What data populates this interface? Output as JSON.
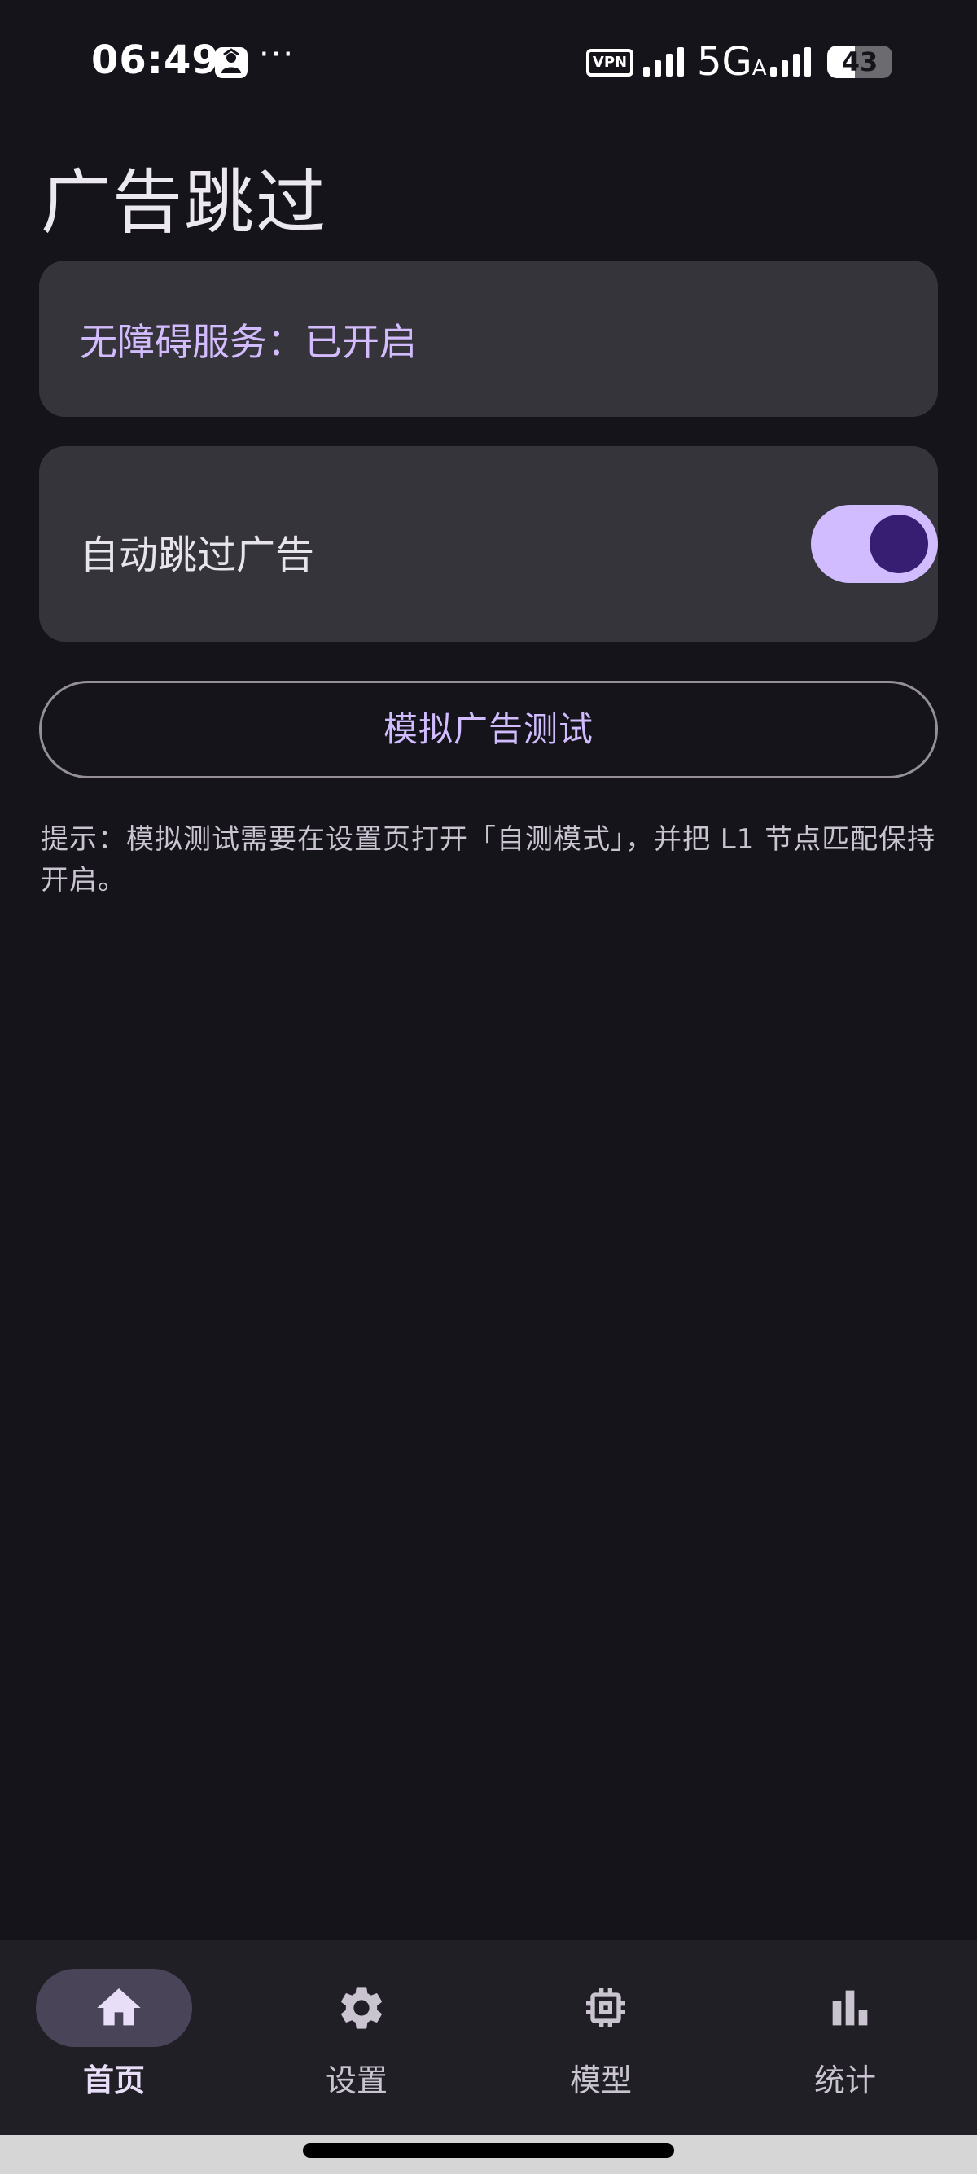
{
  "status_bar": {
    "time": "06:49",
    "app_notification_icon": "portrait-icon",
    "more_indicator": "···",
    "vpn_label": "VPN",
    "network_type": "5G",
    "network_sub": "A",
    "battery_level": "43",
    "battery_fraction": 0.43
  },
  "page": {
    "title": "广告跳过"
  },
  "accessibility_card": {
    "status_text": "无障碍服务：已开启",
    "accent_color": "#d2bcfd"
  },
  "auto_skip_card": {
    "label": "自动跳过广告",
    "toggle_on": true
  },
  "simulate_button": {
    "label": "模拟广告测试"
  },
  "hint": {
    "text": "提示：模拟测试需要在设置页打开「自测模式」，并把 L1 节点匹配保持开启。"
  },
  "bottom_nav": {
    "items": [
      {
        "label": "首页",
        "icon": "home-icon",
        "selected": true
      },
      {
        "label": "设置",
        "icon": "gear-icon",
        "selected": false
      },
      {
        "label": "模型",
        "icon": "chip-icon",
        "selected": false
      },
      {
        "label": "统计",
        "icon": "bar-chart-icon",
        "selected": false
      }
    ]
  },
  "theme": {
    "background": "#16141b",
    "card": "#36343b",
    "primary": "#d0bcff",
    "on_primary": "#381e72"
  }
}
